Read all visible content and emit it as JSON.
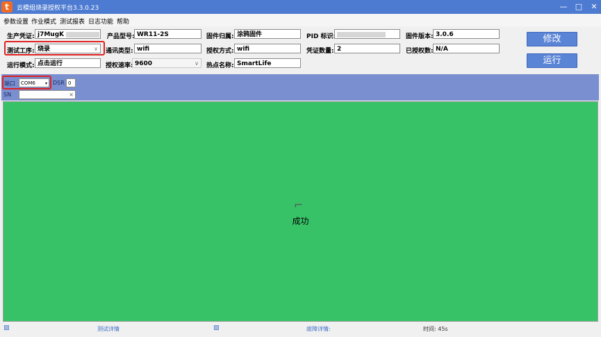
{
  "window": {
    "title": "云模组烧录授权平台3.3.0.23",
    "logo_glyph": "t",
    "minimize": "—",
    "maximize": "□",
    "close": "✕"
  },
  "menu": [
    "参数设置",
    "作业模式",
    "测试报表",
    "日志功能",
    "帮助"
  ],
  "form": {
    "production_credential": {
      "label": "生产凭证:",
      "value": "j7MugK"
    },
    "product_model": {
      "label": "产品型号:",
      "value": "WR11-2S"
    },
    "firmware_owner": {
      "label": "固件归属:",
      "value": "涂鸦固件"
    },
    "pid": {
      "label": "PID 标识:",
      "value": ""
    },
    "firmware_version": {
      "label": "固件版本:",
      "value": "3.0.6"
    },
    "test_process": {
      "label": "测试工序:",
      "value": "烧录"
    },
    "comm_type": {
      "label": "通讯类型:",
      "value": "wifi"
    },
    "auth_method": {
      "label": "授权方式:",
      "value": "wifi"
    },
    "credential_count": {
      "label": "凭证数量:",
      "value": "2"
    },
    "authorized_count": {
      "label": "已授权数:",
      "value": "N/A"
    },
    "run_mode": {
      "label": "运行模式:",
      "value": "点击运行"
    },
    "auth_rate": {
      "label": "授权速率:",
      "value": "9600"
    },
    "hotspot_name": {
      "label": "热点名称:",
      "value": "SmartLife"
    }
  },
  "buttons": {
    "modify": "修改",
    "run": "运行"
  },
  "port": {
    "label": "端口",
    "value": "COM6",
    "dsr_label": "DSR",
    "dsr_value": "0",
    "sn_label": "SN",
    "sn_clear": "×"
  },
  "status": {
    "text": "成功",
    "icon": "cursor-icon",
    "color": "#38c268"
  },
  "footer": {
    "test_details": "测试详情",
    "fault_details": "故障详情:",
    "time": "时间:   45s"
  }
}
